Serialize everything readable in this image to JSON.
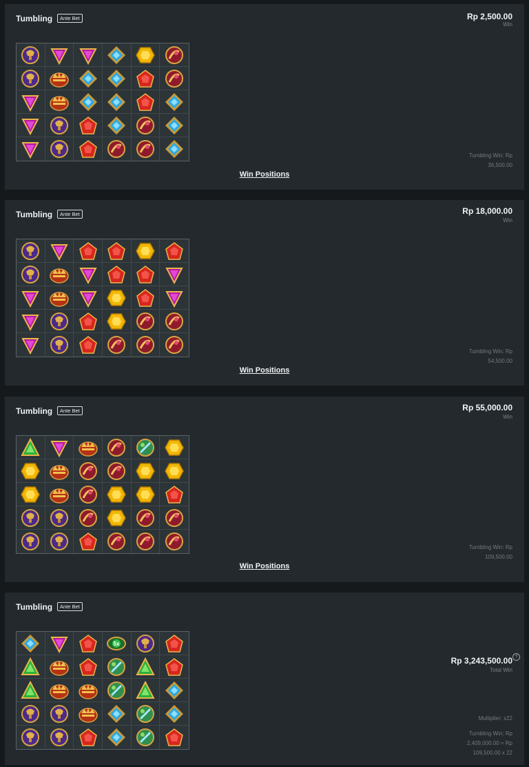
{
  "rounds": [
    {
      "title": "Tumbling",
      "badge": "Ante Bet",
      "amount": "Rp 2,500.00",
      "amount_label": "Win",
      "tumble_line1": "Tumbling Win: Rp",
      "tumble_line2": "36,500.00",
      "link": "Win Positions",
      "grid": [
        [
          "chalice-purple",
          "triangle-purple",
          "triangle-purple",
          "diamond-blue",
          "hexagon-yellow",
          "ring-red"
        ],
        [
          "chalice-purple",
          "crown",
          "diamond-blue",
          "diamond-blue",
          "pentagon-red",
          "ring-red"
        ],
        [
          "triangle-purple",
          "crown",
          "diamond-blue",
          "diamond-blue",
          "pentagon-red",
          "diamond-blue"
        ],
        [
          "triangle-purple",
          "chalice-purple",
          "pentagon-red",
          "diamond-blue",
          "ring-red",
          "diamond-blue"
        ],
        [
          "triangle-purple",
          "chalice-purple",
          "pentagon-red",
          "ring-red",
          "ring-red",
          "diamond-blue"
        ]
      ]
    },
    {
      "title": "Tumbling",
      "badge": "Ante Bet",
      "amount": "Rp 18,000.00",
      "amount_label": "Win",
      "tumble_line1": "Tumbling Win: Rp",
      "tumble_line2": "54,500.00",
      "link": "Win Positions",
      "grid": [
        [
          "chalice-purple",
          "triangle-purple",
          "pentagon-red",
          "pentagon-red",
          "hexagon-yellow",
          "pentagon-red"
        ],
        [
          "chalice-purple",
          "crown",
          "triangle-purple",
          "pentagon-red",
          "pentagon-red",
          "triangle-purple"
        ],
        [
          "triangle-purple",
          "crown",
          "triangle-purple",
          "hexagon-yellow",
          "pentagon-red",
          "triangle-purple"
        ],
        [
          "triangle-purple",
          "chalice-purple",
          "pentagon-red",
          "hexagon-yellow",
          "ring-red",
          "ring-red"
        ],
        [
          "triangle-purple",
          "chalice-purple",
          "pentagon-red",
          "ring-red",
          "ring-red",
          "ring-red"
        ]
      ]
    },
    {
      "title": "Tumbling",
      "badge": "Ante Bet",
      "amount": "Rp 55,000.00",
      "amount_label": "Win",
      "tumble_line1": "Tumbling Win: Rp",
      "tumble_line2": "109,500.00",
      "link": "Win Positions",
      "grid": [
        [
          "triangle-green",
          "triangle-purple",
          "crown",
          "ring-red",
          "orb-green",
          "hexagon-yellow"
        ],
        [
          "hexagon-yellow",
          "crown",
          "ring-red",
          "ring-red",
          "hexagon-yellow",
          "hexagon-yellow"
        ],
        [
          "hexagon-yellow",
          "crown",
          "ring-red",
          "hexagon-yellow",
          "hexagon-yellow",
          "pentagon-red"
        ],
        [
          "chalice-purple",
          "chalice-purple",
          "ring-red",
          "hexagon-yellow",
          "ring-red",
          "ring-red"
        ],
        [
          "chalice-purple",
          "chalice-purple",
          "pentagon-red",
          "ring-red",
          "ring-red",
          "ring-red"
        ]
      ]
    },
    {
      "title": "Tumbling",
      "badge": "Ante Bet",
      "amount": "Rp 3,243,500.00",
      "amount_label": "Total Win",
      "multiplier": "Multiplier: x22",
      "tumble_line1": "Tumbling Win: Rp",
      "tumble_line2": "2,409,000.00 = Rp",
      "tumble_line3": "109,500.00 x 22",
      "multiplier_symbol_text": "5x",
      "grid": [
        [
          "diamond-blue",
          "triangle-purple",
          "pentagon-red",
          "multiplier",
          "chalice-purple",
          "pentagon-red"
        ],
        [
          "triangle-green",
          "crown",
          "pentagon-red",
          "orb-green",
          "triangle-green",
          "pentagon-red"
        ],
        [
          "triangle-green",
          "crown",
          "crown",
          "orb-green",
          "triangle-green",
          "diamond-blue"
        ],
        [
          "chalice-purple",
          "chalice-purple",
          "crown",
          "diamond-blue",
          "orb-green",
          "diamond-blue"
        ],
        [
          "chalice-purple",
          "chalice-purple",
          "pentagon-red",
          "diamond-blue",
          "orb-green",
          "pentagon-red"
        ]
      ]
    }
  ],
  "colors": {
    "background": "#15191c",
    "panel": "#23292d",
    "grid_bg": "#2d3438"
  }
}
